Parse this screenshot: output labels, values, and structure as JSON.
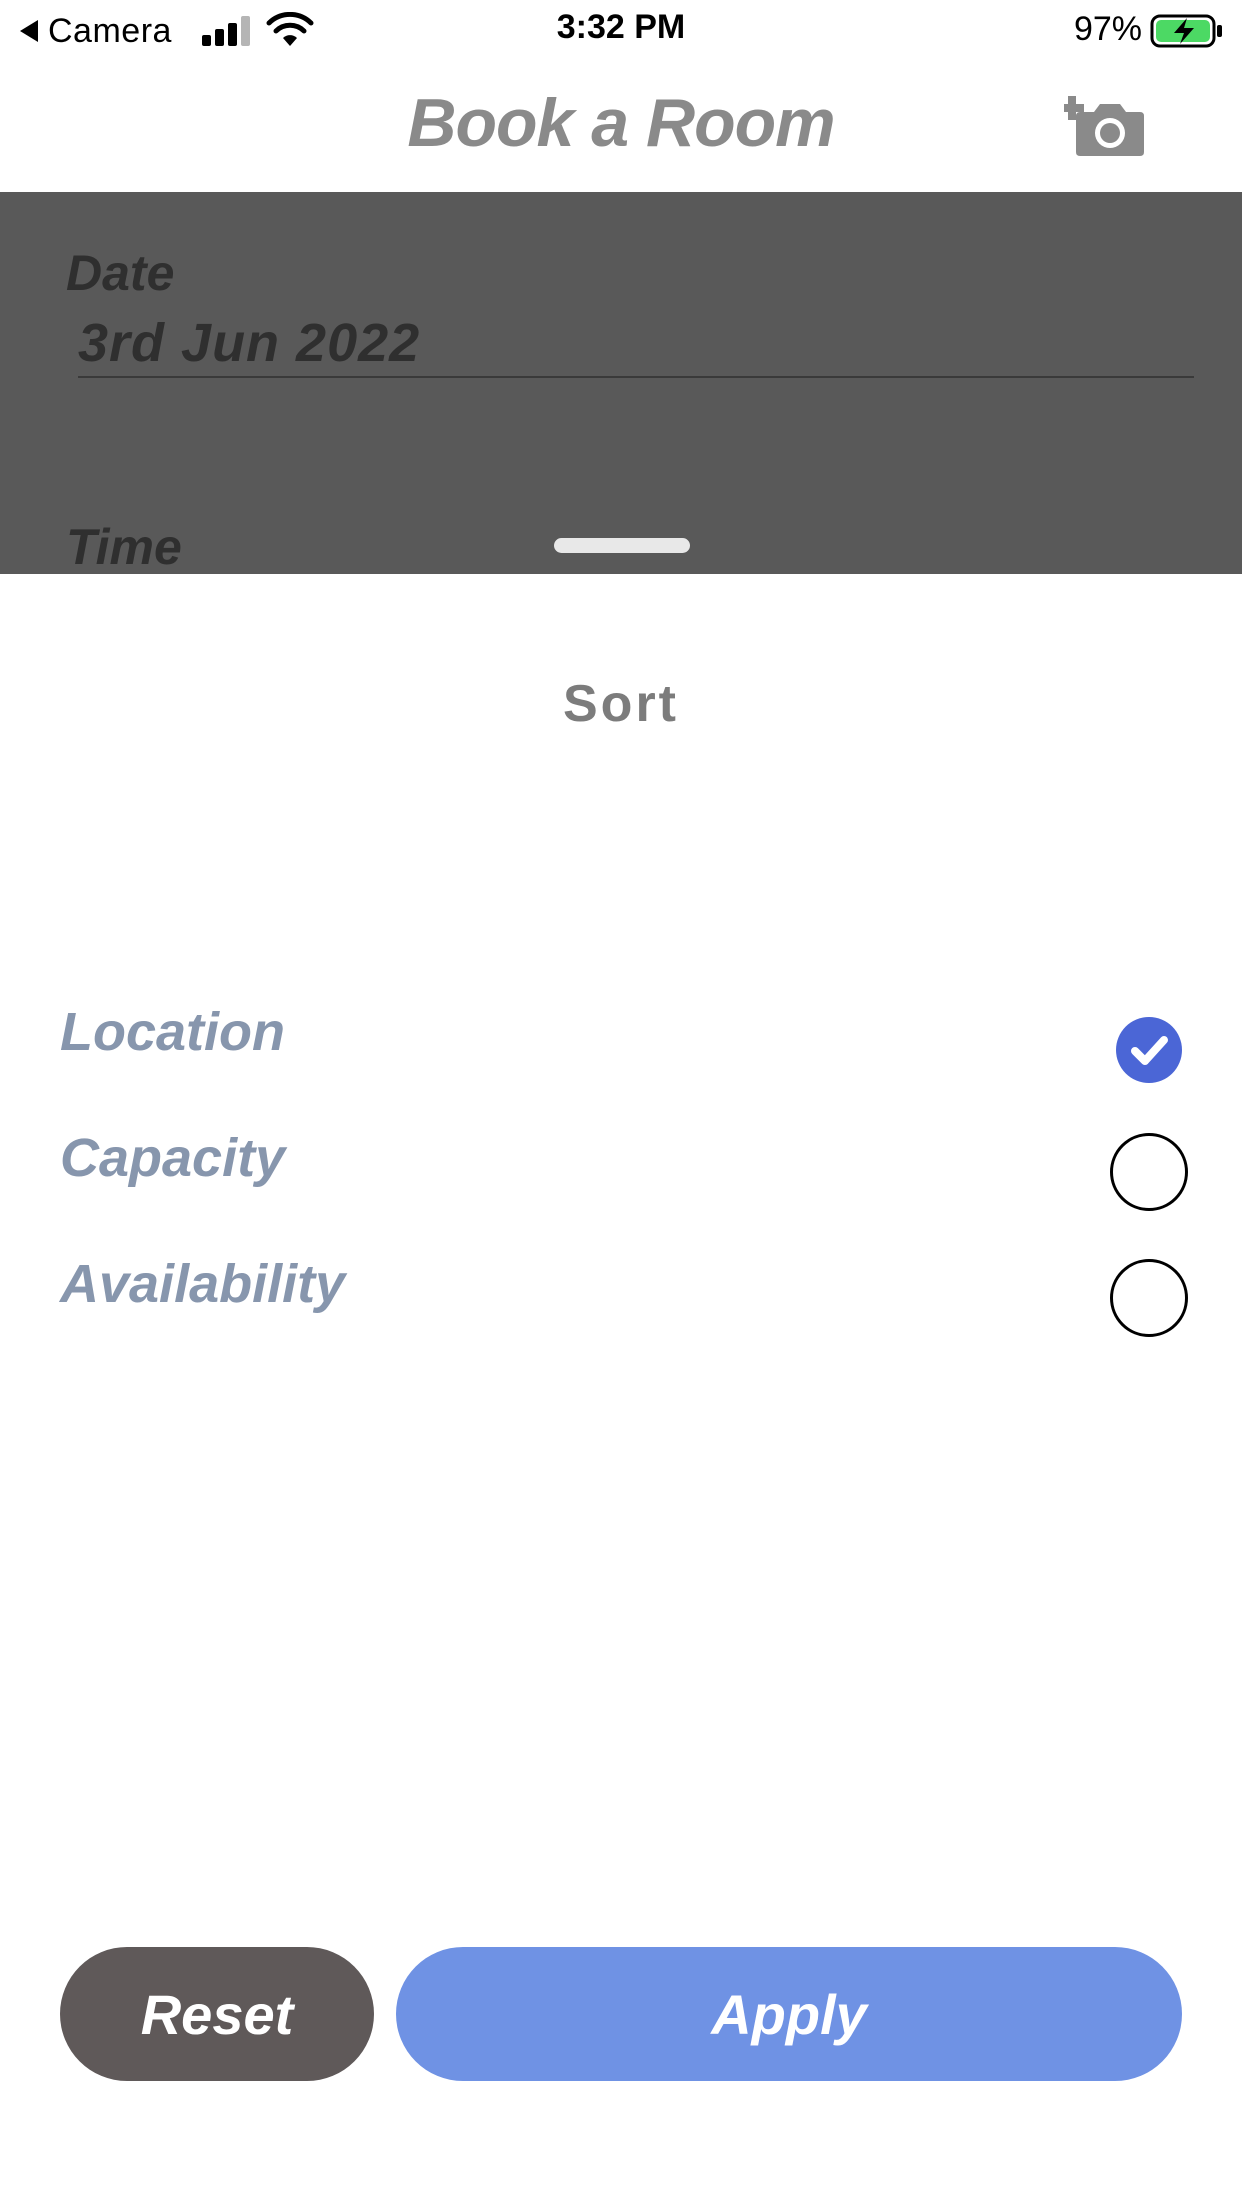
{
  "status_bar": {
    "back_app": "Camera",
    "time": "3:32 PM",
    "battery_percent": "97%",
    "icons": [
      "back-triangle-icon",
      "cellular-signal-icon",
      "wifi-icon",
      "battery-charging-icon"
    ]
  },
  "header": {
    "title": "Book a Room",
    "action_icon": "add-photo-camera-icon"
  },
  "form": {
    "date_label": "Date",
    "date_value": "3rd Jun 2022",
    "time_label": "Time"
  },
  "sort_sheet": {
    "title": "Sort",
    "options": [
      {
        "label": "Location",
        "selected": true
      },
      {
        "label": "Capacity",
        "selected": false
      },
      {
        "label": "Availability",
        "selected": false
      }
    ],
    "reset_label": "Reset",
    "apply_label": "Apply"
  },
  "colors": {
    "selected_accent": "#4b66d6",
    "apply_button": "#6f92e4",
    "reset_button": "#5f5959",
    "option_text": "#8796ad",
    "overlay": "#595959"
  }
}
